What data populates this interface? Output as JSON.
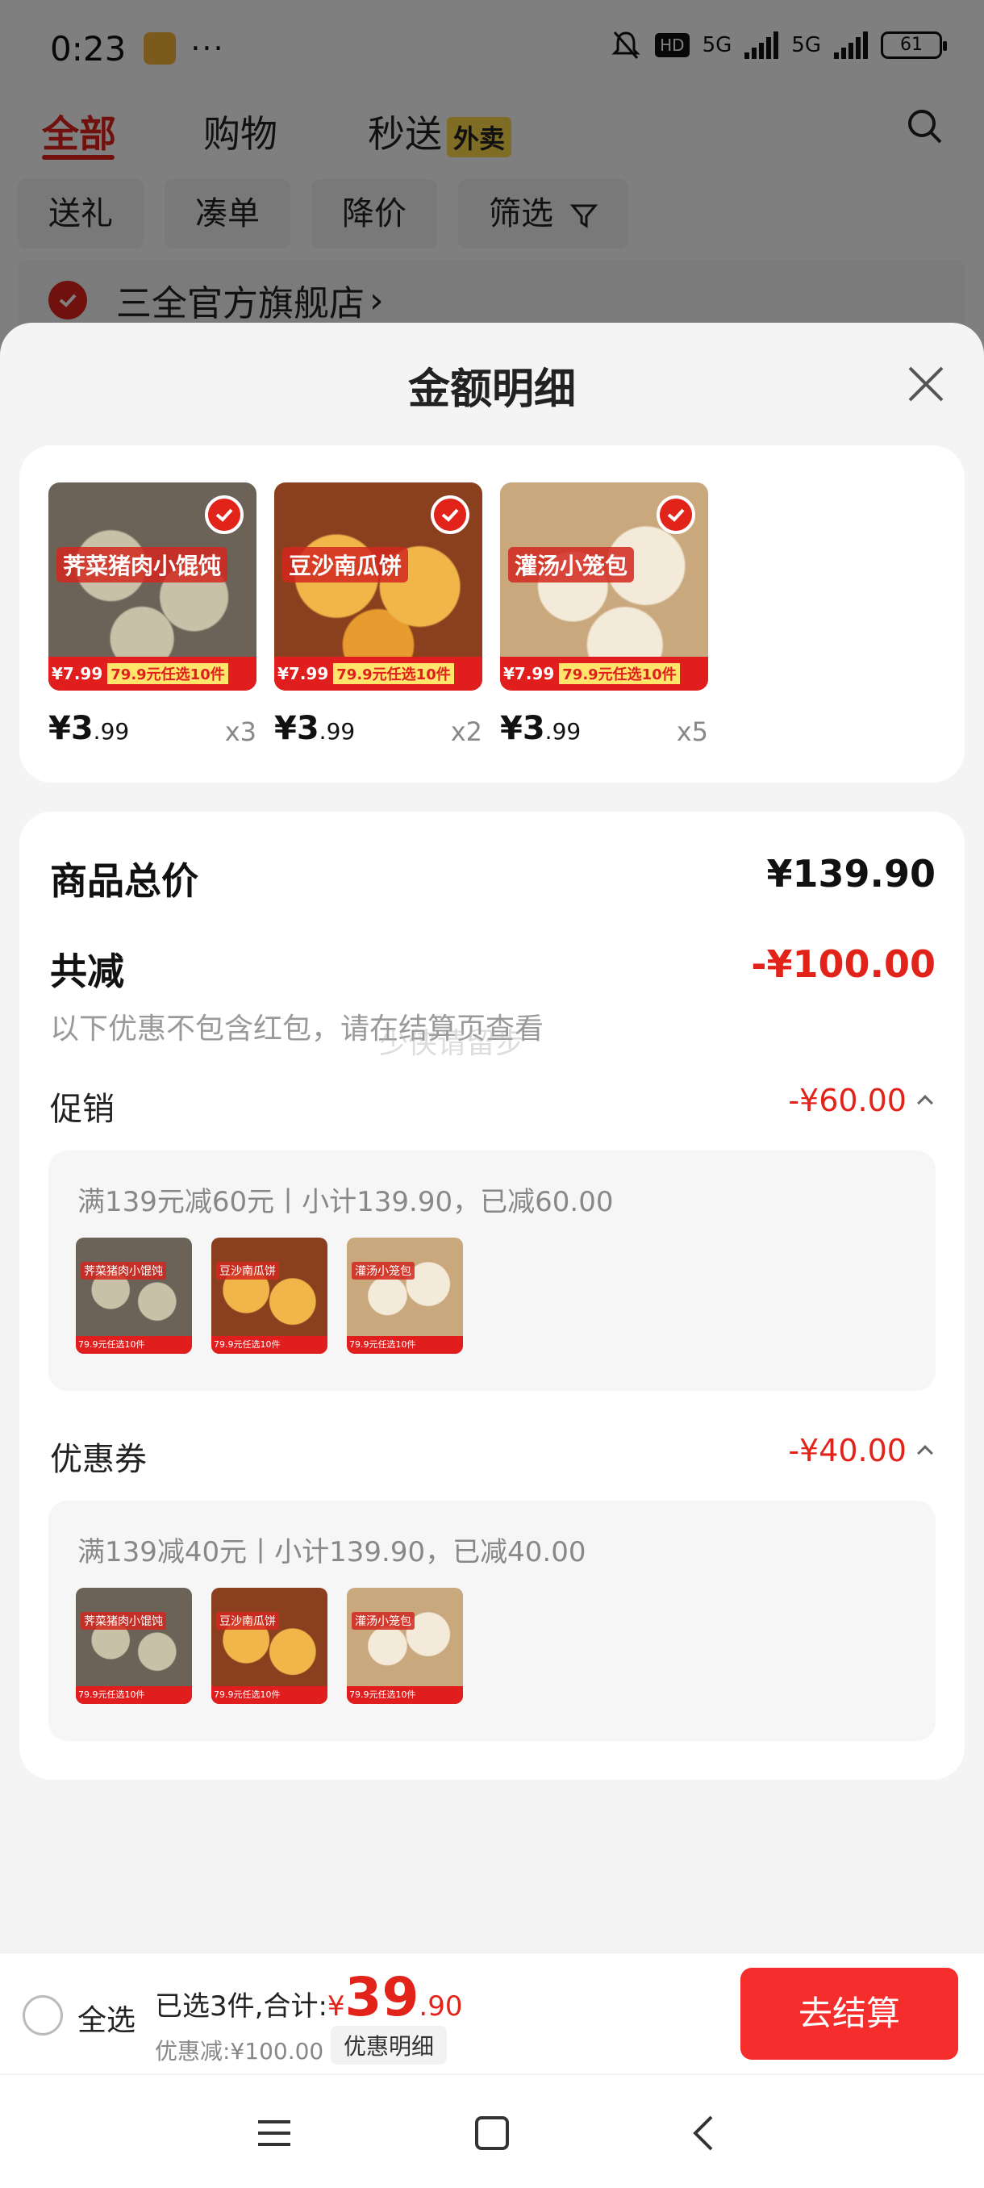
{
  "status_bar": {
    "time": "0:23",
    "dots": "···",
    "hd": "HD",
    "net1": "5G",
    "net2": "5G",
    "battery": "61"
  },
  "top_tabs": {
    "all": "全部",
    "shopping": "购物",
    "instant": "秒送",
    "takeout_badge": "外卖"
  },
  "filters": [
    "送礼",
    "凑单",
    "降价",
    "筛选"
  ],
  "store": {
    "name": "三全官方旗舰店",
    "chevron": "›"
  },
  "sheet": {
    "title": "金额明细"
  },
  "products": [
    {
      "name": "荠菜猪肉小馄饨",
      "price_int": "¥3",
      "price_dec": ".99",
      "qty": "x3",
      "bar_price": "¥7.99",
      "bar_deal": "79.9元任选10件",
      "bg": "#6b6258"
    },
    {
      "name": "豆沙南瓜饼",
      "price_int": "¥3",
      "price_dec": ".99",
      "qty": "x2",
      "bar_price": "¥7.99",
      "bar_deal": "79.9元任选10件",
      "bg": "#e9a33a"
    },
    {
      "name": "灌汤小笼包",
      "price_int": "¥3",
      "price_dec": ".99",
      "qty": "x5",
      "bar_price": "¥7.99",
      "bar_deal": "79.9元任选10件",
      "bg": "#e8d9c0"
    }
  ],
  "summary": {
    "total_label": "商品总价",
    "total_value": "¥139.90",
    "reduce_label": "共减",
    "reduce_value": "-¥100.00",
    "note": "以下优惠不包含红包，请在结算页查看",
    "promo_label": "促销",
    "promo_value": "-¥60.00",
    "promo_text": "满139元减60元丨小计139.90，已减60.00",
    "coupon_label": "优惠券",
    "coupon_value": "-¥40.00",
    "coupon_text": "满139减40元丨小计139.90，已减40.00"
  },
  "watermark": "少侠请留步",
  "checkout": {
    "select_all": "全选",
    "selected_text": "已选3件,合计:",
    "yen": "¥",
    "total_int": "39",
    "total_dec": ".90",
    "discount_text": "优惠减:¥100.00",
    "detail_chip": "优惠明细",
    "button": "去结算"
  },
  "colors": {
    "accent_red": "#e2231a",
    "button_red": "#f52d2d",
    "badge_yellow": "#ffd84a"
  }
}
